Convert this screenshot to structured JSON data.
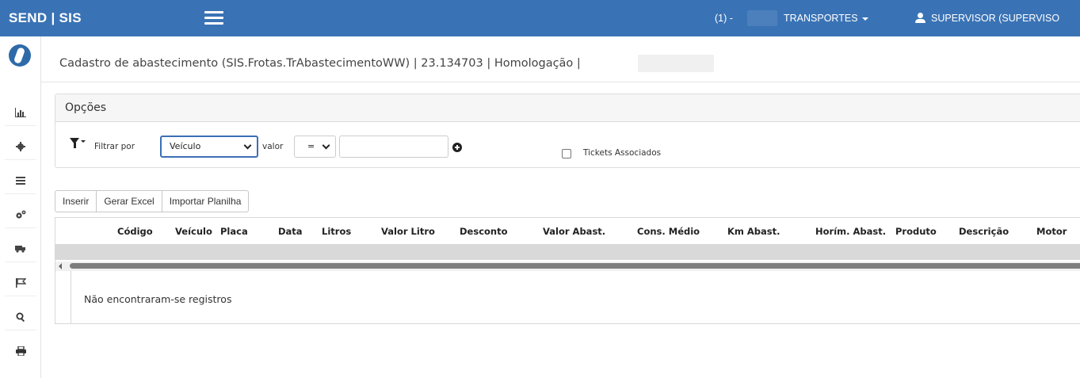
{
  "header": {
    "brand": "SEND | SIS",
    "company_code": "(1) -",
    "company_menu": "TRANSPORTES",
    "user_menu": "SUPERVISOR (SUPERVISO"
  },
  "sidebar": {
    "icons": [
      "app-logo",
      "chart-icon",
      "gear-icon",
      "list-icon",
      "cogs-icon",
      "truck-icon",
      "flag-icon",
      "search-icon",
      "print-icon"
    ]
  },
  "page": {
    "title": "Cadastro de abastecimento (SIS.Frotas.TrAbastecimentoWW) | 23.134703 | Homologação |"
  },
  "options": {
    "heading": "Opções",
    "filter_label": "Filtrar por",
    "filter_field_value": "Veículo",
    "value_label": "valor",
    "operator_value": "=",
    "value_input": "",
    "tickets_label": "Tickets Associados"
  },
  "toolbar": {
    "insert_label": "Inserir",
    "excel_label": "Gerar Excel",
    "import_label": "Importar Planilha"
  },
  "grid": {
    "columns": [
      "Código",
      "Veículo",
      "Placa",
      "Data",
      "Litros",
      "Valor Litro",
      "Desconto",
      "Valor Abast.",
      "Cons. Médio",
      "Km Abast.",
      "Horím. Abast.",
      "Produto",
      "Descrição",
      "Motor"
    ],
    "empty_message": "Não encontraram-se registros"
  }
}
